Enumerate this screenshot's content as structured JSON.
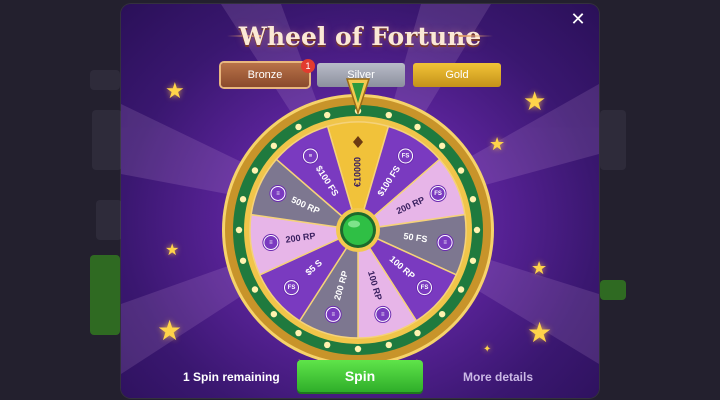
{
  "modal": {
    "title": "Wheel of Fortune",
    "close_label": "✕"
  },
  "tiers": [
    {
      "label": "Bronze",
      "badge": "1"
    },
    {
      "label": "Silver"
    },
    {
      "label": "Gold"
    }
  ],
  "wheel": {
    "segments": [
      {
        "label": "€10000",
        "color": "#f1c23a"
      },
      {
        "label": "$100 FS",
        "color": "#7a3ac0"
      },
      {
        "label": "200 RP",
        "color": "#e7b5e8"
      },
      {
        "label": "50 FS",
        "color": "#7d7790"
      },
      {
        "label": "100 RP",
        "color": "#7a3ac0"
      },
      {
        "label": "100 RP",
        "color": "#e7b5e8"
      },
      {
        "label": "200 RP",
        "color": "#7d7790"
      },
      {
        "label": "$5 S",
        "color": "#7a3ac0"
      },
      {
        "label": "200 RP",
        "color": "#e7b5e8"
      },
      {
        "label": "500 RP",
        "color": "#7d7790"
      },
      {
        "label": "$100 FS",
        "color": "#7a3ac0"
      }
    ],
    "icon_labels": [
      "FS",
      "FS",
      "≡",
      "FS",
      "≡",
      "≡",
      "FS",
      "≡",
      "≡",
      "≡"
    ]
  },
  "footer": {
    "spins_remaining": "1 Spin remaining",
    "spin_button": "Spin",
    "more_details": "More details"
  }
}
